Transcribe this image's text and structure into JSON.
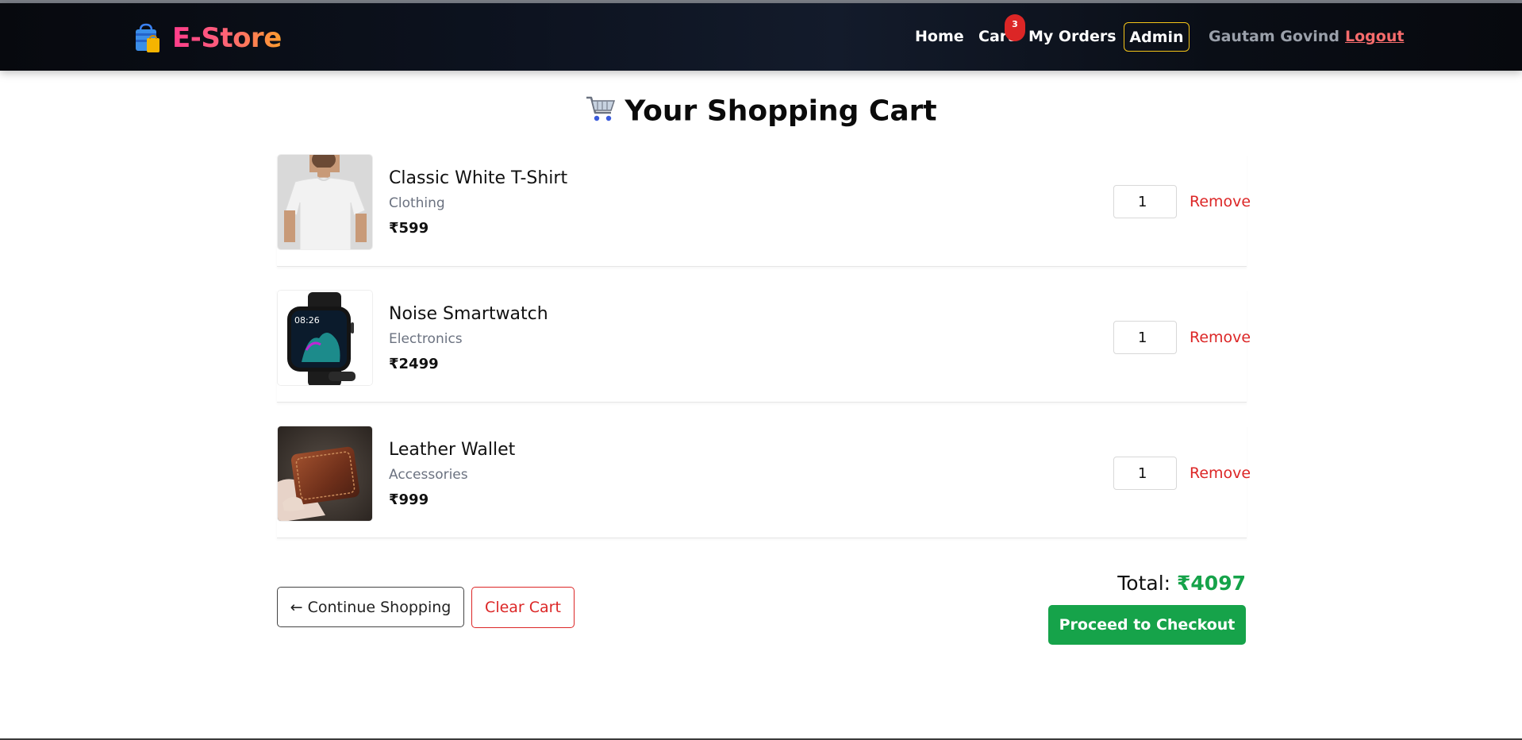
{
  "navbar": {
    "brand_icon": "shopping-bag-icon",
    "brand": "E-Store",
    "links": {
      "home": "Home",
      "cart": "Cart",
      "orders": "My Orders"
    },
    "cart_count": "3",
    "admin": "Admin",
    "user": "Gautam Govind",
    "logout": "Logout"
  },
  "page": {
    "title_icon": "shopping-cart-icon",
    "title": "Your Shopping Cart"
  },
  "cart": {
    "items": [
      {
        "name": "Classic White T-Shirt",
        "category": "Clothing",
        "price": "₹599",
        "qty": "1",
        "remove": "Remove",
        "image": "tshirt-image"
      },
      {
        "name": "Noise Smartwatch",
        "category": "Electronics",
        "price": "₹2499",
        "qty": "1",
        "remove": "Remove",
        "image": "smartwatch-image",
        "watch_time": "08:26"
      },
      {
        "name": "Leather Wallet",
        "category": "Accessories",
        "price": "₹999",
        "qty": "1",
        "remove": "Remove",
        "image": "wallet-image"
      }
    ]
  },
  "actions": {
    "continue": "← Continue Shopping",
    "clear": "Clear Cart",
    "total_label": "Total:",
    "total_value": "₹4097",
    "checkout": "Proceed to Checkout"
  },
  "colors": {
    "accent_green": "#16a34a",
    "danger_red": "#dc2626",
    "admin_border": "#f5c518",
    "nav_bg": "#0d1320"
  }
}
